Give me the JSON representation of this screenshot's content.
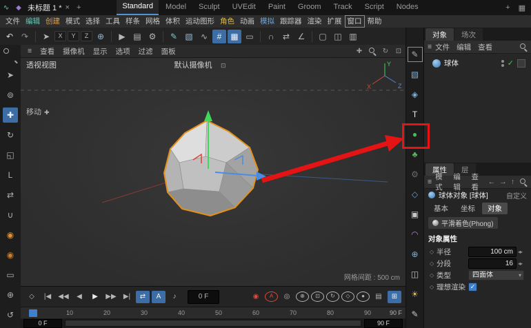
{
  "ui": {
    "menu_icon": "≡",
    "close": "×",
    "check": "✓",
    "dot": "◇",
    "stepper": "◂▸",
    "dropdown_arrow": "▾",
    "camera_badge": "⊡",
    "move_cross": "✚"
  },
  "titlebar": {
    "app_icons": [
      {
        "name": "app-history-icon",
        "glyph": "∿",
        "color": "#7ec8c0"
      },
      {
        "name": "app-asset-icon",
        "glyph": "◆",
        "color": "#9a7bd0"
      }
    ],
    "doc_tab": {
      "label": "未标题 1 *"
    },
    "new_tab": "+",
    "layout_tabs": [
      {
        "name": "layout-tab-standard",
        "label": "Standard",
        "active": true
      },
      {
        "name": "layout-tab-model",
        "label": "Model"
      },
      {
        "name": "layout-tab-sculpt",
        "label": "Sculpt"
      },
      {
        "name": "layout-tab-uvedit",
        "label": "UVEdit"
      },
      {
        "name": "layout-tab-paint",
        "label": "Paint"
      },
      {
        "name": "layout-tab-groom",
        "label": "Groom"
      },
      {
        "name": "layout-tab-track",
        "label": "Track"
      },
      {
        "name": "layout-tab-script",
        "label": "Script"
      },
      {
        "name": "layout-tab-nodes",
        "label": "Nodes"
      }
    ],
    "add_layout": "+",
    "layout_grid_icon": "▦"
  },
  "menubar": {
    "items": [
      {
        "name": "menu-file",
        "label": "文件"
      },
      {
        "name": "menu-edit",
        "label": "编辑",
        "color": "#6cc5b5"
      },
      {
        "name": "menu-create",
        "label": "创建",
        "color": "#e0a14e"
      },
      {
        "name": "menu-mode",
        "label": "模式"
      },
      {
        "name": "menu-select",
        "label": "选择"
      },
      {
        "name": "menu-tools",
        "label": "工具"
      },
      {
        "name": "menu-spline",
        "label": "样条"
      },
      {
        "name": "menu-mesh",
        "label": "网格"
      },
      {
        "name": "menu-volume",
        "label": "体积"
      },
      {
        "name": "menu-mograph",
        "label": "运动图形"
      },
      {
        "name": "menu-character",
        "label": "角色",
        "color": "#d8b94f"
      },
      {
        "name": "menu-animate",
        "label": "动画"
      },
      {
        "name": "menu-simulate",
        "label": "模拟",
        "color": "#6fa8dc"
      },
      {
        "name": "menu-tracker",
        "label": "跟踪器"
      },
      {
        "name": "menu-render",
        "label": "渲染"
      },
      {
        "name": "menu-extensions",
        "label": "扩展"
      },
      {
        "name": "menu-window",
        "label": "窗口",
        "bordered": true
      },
      {
        "name": "menu-help",
        "label": "帮助"
      }
    ]
  },
  "toolbar": {
    "icons": [
      {
        "name": "undo-icon",
        "glyph": "↶",
        "color": "#d8d8d8"
      },
      {
        "name": "redo-icon",
        "glyph": "↷",
        "color": "#8f8f8f"
      },
      {
        "divider": true
      },
      {
        "name": "select-arrow-icon",
        "glyph": "➤"
      },
      {
        "name": "axis-x-button",
        "label": "X",
        "cls": "key"
      },
      {
        "name": "axis-y-button",
        "label": "Y",
        "cls": "key"
      },
      {
        "name": "axis-z-button",
        "label": "Z",
        "cls": "key"
      },
      {
        "name": "coordinate-system-icon",
        "glyph": "⊕",
        "color": "#8fb8d8"
      },
      {
        "divider": true
      },
      {
        "name": "render-view-icon",
        "glyph": "▶"
      },
      {
        "name": "render-picture-viewer-icon",
        "glyph": "▤"
      },
      {
        "name": "render-settings-icon",
        "glyph": "⚙"
      },
      {
        "divider": true
      },
      {
        "name": "pen-tool-icon",
        "glyph": "✎",
        "color": "#7ec8c0"
      },
      {
        "name": "cube-primitive-icon",
        "glyph": "▧",
        "color": "#8fb8d8"
      },
      {
        "name": "spline-pen-icon",
        "glyph": "∿"
      },
      {
        "name": "snap-grid-icon",
        "glyph": "#",
        "hl": true
      },
      {
        "name": "quantize-grid-icon",
        "glyph": "▦",
        "hl": true
      },
      {
        "name": "workplane-icon",
        "glyph": "▭"
      },
      {
        "divider": true
      },
      {
        "name": "magnet-icon",
        "glyph": "∩"
      },
      {
        "name": "mirror-icon",
        "glyph": "⇄"
      },
      {
        "name": "axis-edit-icon",
        "glyph": "∠"
      },
      {
        "divider": true
      },
      {
        "name": "layout-single-icon",
        "glyph": "▢"
      },
      {
        "name": "layout-split-icon",
        "glyph": "◫"
      },
      {
        "name": "layout-quad-icon",
        "glyph": "▥"
      }
    ]
  },
  "left_toolbar": {
    "icons": [
      {
        "name": "zoom-icon",
        "cls": "icon-mag"
      },
      {
        "name": "select-arrow-icon",
        "glyph": "➤"
      },
      {
        "name": "lasso-select-icon",
        "glyph": "⊚"
      },
      {
        "name": "move-icon",
        "glyph": "✚",
        "hl": true
      },
      {
        "name": "rotate-icon",
        "glyph": "↻"
      },
      {
        "name": "scale-icon",
        "glyph": "◱"
      },
      {
        "name": "coordinate-icon",
        "glyph": "L"
      },
      {
        "name": "mirror-icon",
        "glyph": "⇄"
      },
      {
        "name": "snap-icon",
        "glyph": "∪"
      },
      {
        "name": "simulation-particles-icon",
        "glyph": "◉",
        "color": "#e09030"
      },
      {
        "name": "simulation-cache-icon",
        "glyph": "◉",
        "color": "#c87f2c"
      },
      {
        "name": "workplane-icon",
        "glyph": "▭"
      },
      {
        "name": "modeling-axis-icon",
        "glyph": "⊕"
      },
      {
        "name": "history-icon",
        "glyph": "↺"
      }
    ]
  },
  "right_strip": {
    "icons": [
      {
        "name": "spline-pen-icon",
        "glyph": "✎",
        "bordered": true
      },
      {
        "name": "cube-primitive-icon",
        "glyph": "▧",
        "color": "#7fb2d9"
      },
      {
        "name": "volume-mesh-icon",
        "glyph": "◈",
        "color": "#7fb2d9"
      },
      {
        "name": "text-tool-icon",
        "label": "T",
        "color": "#e8e8e8"
      },
      {
        "name": "sphere-primitive-icon",
        "glyph": "●",
        "color": "#3dc24d"
      },
      {
        "name": "mograph-cloner-icon",
        "glyph": "♣",
        "color": "#58b658"
      },
      {
        "name": "volume-builder-icon",
        "glyph": "⚙",
        "color": "#6a6a6a"
      },
      {
        "name": "dynamics-icon",
        "glyph": "◇",
        "color": "#6fa0d8"
      },
      {
        "name": "field-icon",
        "glyph": "▣",
        "color": "#c8c8c8"
      },
      {
        "name": "deformer-icon",
        "glyph": "◠",
        "color": "#b08ad0"
      },
      {
        "name": "environment-icon",
        "glyph": "⊕",
        "color": "#7fb2d9"
      },
      {
        "name": "camera-icon",
        "glyph": "◫",
        "color": "#c8c8c8"
      },
      {
        "name": "light-icon",
        "glyph": "☀",
        "color": "#e0c060"
      },
      {
        "name": "render-pen-icon",
        "glyph": "✎",
        "color": "#c8c8c8"
      }
    ]
  },
  "viewport": {
    "menu": [
      {
        "name": "vp-menu-view",
        "label": "查看"
      },
      {
        "name": "vp-menu-camera",
        "label": "摄像机"
      },
      {
        "name": "vp-menu-display",
        "label": "显示"
      },
      {
        "name": "vp-menu-options",
        "label": "选项"
      },
      {
        "name": "vp-menu-filter",
        "label": "过滤"
      },
      {
        "name": "vp-menu-panel",
        "label": "面板"
      }
    ],
    "view_controls": [
      {
        "name": "pan-view-icon",
        "glyph": "✚"
      },
      {
        "name": "zoom-view-icon",
        "cls": "icon-mag"
      },
      {
        "name": "rotate-view-icon",
        "glyph": "↻"
      },
      {
        "name": "maximize-view-icon",
        "glyph": "⊡"
      }
    ],
    "label": "透视视图",
    "camera_label": "默认摄像机",
    "tool_hint": "移动",
    "grid_info": "网格间距 : 500 cm",
    "axis_labels": {
      "x": "X",
      "y": "Y",
      "z": "Z"
    }
  },
  "timeline": {
    "left_icons": [
      {
        "name": "make-keyframe-icon",
        "glyph": "◇"
      },
      {
        "name": "go-start-button",
        "glyph": "|◀"
      },
      {
        "name": "prev-key-button",
        "glyph": "◀◀"
      },
      {
        "name": "prev-frame-button",
        "glyph": "◀"
      },
      {
        "name": "play-button",
        "glyph": "▶",
        "color": "#ececec"
      },
      {
        "name": "next-key-button",
        "glyph": "▶▶"
      },
      {
        "name": "go-end-button",
        "glyph": "▶|"
      },
      {
        "name": "loop-mode-button",
        "glyph": "⇄",
        "hl": true
      },
      {
        "name": "keyframe-selection-button",
        "label": "A",
        "hl": true
      },
      {
        "name": "sound-button",
        "glyph": "♪"
      }
    ],
    "frame_field": "0 F",
    "record_icons": [
      {
        "name": "record-keyframe-button",
        "glyph": "◉",
        "cls": "red"
      },
      {
        "name": "autokey-button",
        "label": "A",
        "cls": "red circ"
      },
      {
        "name": "record-camera-button",
        "glyph": "◎"
      },
      {
        "name": "keyframe-position-toggle",
        "glyph": "⊕",
        "cls": "circ"
      },
      {
        "name": "keyframe-scale-toggle",
        "glyph": "⊡",
        "cls": "circ"
      },
      {
        "name": "keyframe-rotation-toggle",
        "glyph": "↻",
        "cls": "circ"
      },
      {
        "name": "keyframe-parameter-toggle",
        "glyph": "◇",
        "cls": "circ"
      },
      {
        "name": "keyframe-pla-toggle",
        "glyph": "●",
        "cls": "circ"
      },
      {
        "name": "keyframe-settings-button",
        "glyph": "▤"
      },
      {
        "name": "timeline-window-button",
        "glyph": "⊞",
        "hl": true,
        "cls": "endbtn"
      }
    ],
    "ticks": [
      "0",
      "10",
      "20",
      "30",
      "40",
      "50",
      "60",
      "70",
      "80",
      "90"
    ],
    "end_label": "90 F",
    "range_start": "0 F",
    "range_end": "90 F"
  },
  "object_panel": {
    "tabs": [
      {
        "name": "tab-objects",
        "label": "对象",
        "active": true
      },
      {
        "name": "tab-takes",
        "label": "场次"
      }
    ],
    "menu": [
      {
        "name": "obj-menu-file",
        "label": "文件"
      },
      {
        "name": "obj-menu-edit",
        "label": "编辑"
      },
      {
        "name": "obj-menu-view",
        "label": "查看"
      }
    ],
    "objects": [
      {
        "name": "球体"
      }
    ]
  },
  "attribute_panel": {
    "tabs": [
      {
        "name": "tab-attributes",
        "label": "属性",
        "active": true
      },
      {
        "name": "tab-layers",
        "label": "层"
      }
    ],
    "menu": [
      {
        "name": "attr-menu-mode",
        "label": "模式"
      },
      {
        "name": "attr-menu-edit",
        "label": "编辑"
      },
      {
        "name": "attr-menu-view",
        "label": "查看"
      }
    ],
    "nav_icons": [
      {
        "name": "nav-back-icon",
        "glyph": "←"
      },
      {
        "name": "nav-forward-icon",
        "glyph": "→"
      },
      {
        "name": "nav-up-icon",
        "glyph": "↑"
      }
    ],
    "customize_label": "自定义",
    "object_title": "球体对象 [球体]",
    "prop_tabs": [
      {
        "name": "prop-tab-basic",
        "label": "基本"
      },
      {
        "name": "prop-tab-coord",
        "label": "坐标"
      },
      {
        "name": "prop-tab-object",
        "label": "对象",
        "active": true
      }
    ],
    "phong_tag": "平滑着色(Phong)",
    "section_title": "对象属性",
    "rows": [
      {
        "label": "半径",
        "value": "100 cm",
        "type": "field"
      },
      {
        "label": "分段",
        "value": "16",
        "type": "field"
      },
      {
        "label": "类型",
        "value": "四面体",
        "type": "dropdown"
      },
      {
        "label": "理想渲染",
        "checked": true,
        "type": "checkbox"
      }
    ]
  }
}
